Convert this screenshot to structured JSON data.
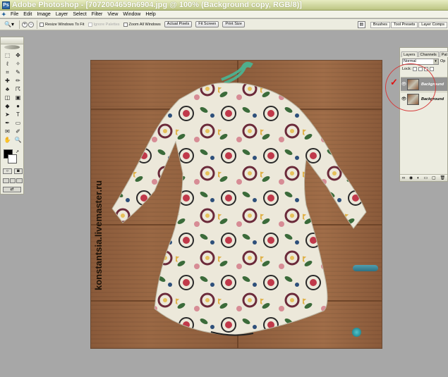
{
  "window": {
    "title": "Adobe Photoshop - [7072004659n6904.jpg @ 100% (Background copy, RGB/8)]",
    "app_icon_glyph": "Ps"
  },
  "menu": {
    "items": [
      "File",
      "Edit",
      "Image",
      "Layer",
      "Select",
      "Filter",
      "View",
      "Window",
      "Help"
    ]
  },
  "options_bar": {
    "tool_icon": "zoom-icon",
    "zoom_in_glyph": "+",
    "zoom_out_glyph": "−",
    "resize_windows": "Resize Windows To Fit",
    "ignore_palettes": "Ignore Palettes",
    "zoom_all_windows": "Zoom All Windows",
    "actual_pixels": "Actual Pixels",
    "fit_screen": "Fit Screen",
    "print_size": "Print Size",
    "palette_well_tabs": [
      "Brushes",
      "Tool Presets",
      "Layer Comps"
    ]
  },
  "toolbox": {
    "tool_icons": [
      "marquee-icon",
      "move-icon",
      "lasso-icon",
      "magic-wand-icon",
      "crop-icon",
      "slice-icon",
      "healing-icon",
      "brush-icon",
      "stamp-icon",
      "history-brush-icon",
      "eraser-icon",
      "gradient-icon",
      "blur-icon",
      "dodge-icon",
      "path-select-icon",
      "type-icon",
      "pen-icon",
      "shape-icon",
      "notes-icon",
      "eyedropper-icon",
      "hand-icon",
      "zoom-icon"
    ],
    "tool_glyphs": [
      "⬚",
      "✥",
      "ℓ",
      "✧",
      "⌗",
      "✎",
      "✚",
      "✏",
      "♣",
      "☈",
      "◫",
      "▣",
      "◆",
      "●",
      "➤",
      "T",
      "✒",
      "▭",
      "✉",
      "✐",
      "✋",
      "🔍"
    ]
  },
  "canvas": {
    "watermark": "konstantsia.livemaster.ru",
    "background_color": "#8a5a3a",
    "dress_color": "#ece8da",
    "hanger_color": "#4fae8c"
  },
  "layers_panel": {
    "tabs": [
      "Layers",
      "Channels",
      "Pat"
    ],
    "blend_mode": "Normal",
    "opacity_label": "Op",
    "lock_label": "Lock:",
    "layers": [
      {
        "name": "Background",
        "selected": true
      },
      {
        "name": "Background",
        "selected": false
      }
    ],
    "footer_glyphs": [
      "∞",
      "◉",
      "◐",
      "▭",
      "▢",
      "🗑"
    ]
  },
  "annotation": {
    "mark": "✓",
    "color": "#d63a3a"
  }
}
